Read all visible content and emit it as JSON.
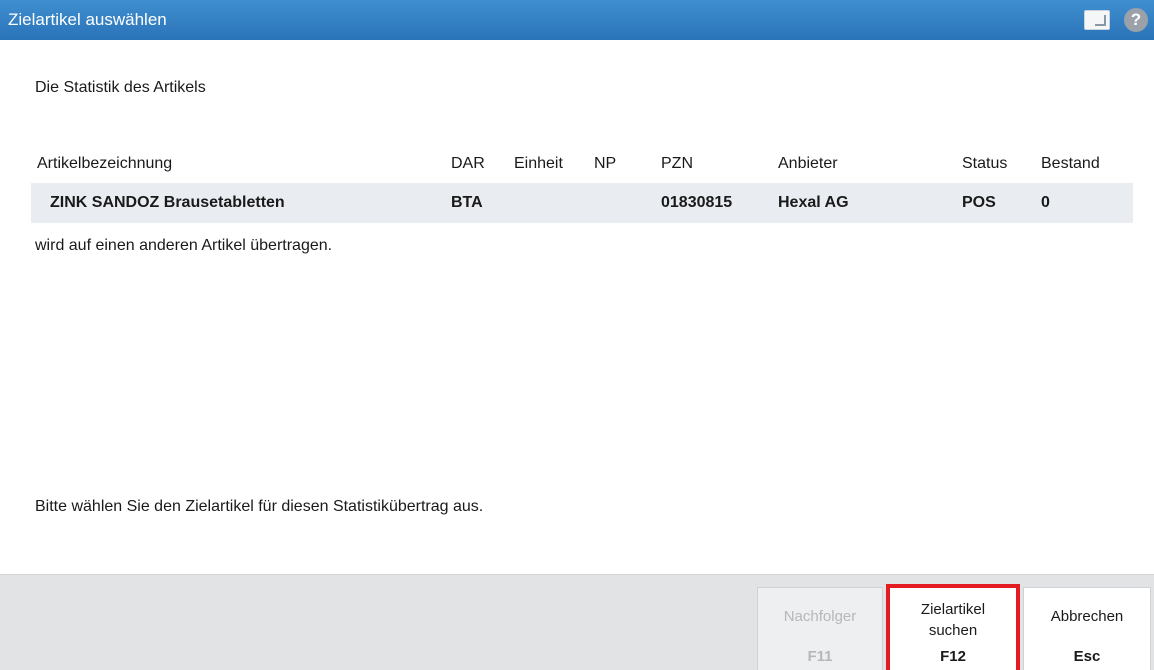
{
  "window": {
    "title": "Zielartikel auswählen",
    "icons": [
      "window-switch-icon",
      "help-icon"
    ],
    "help_glyph": "?"
  },
  "intro": "Die Statistik des Artikels",
  "table": {
    "headers": [
      "Artikelbezeichnung",
      "DAR",
      "Einheit",
      "NP",
      "PZN",
      "Anbieter",
      "Status",
      "Bestand"
    ],
    "row": {
      "name": "ZINK SANDOZ Brausetabletten",
      "dar": "BTA",
      "einheit": "",
      "np": "",
      "pzn": "01830815",
      "anbieter": "Hexal AG",
      "status": "POS",
      "bestand": "0"
    }
  },
  "note_transfer": "wird auf einen anderen Artikel übertragen.",
  "note_choose": "Bitte wählen Sie den Zielartikel für diesen Statistikübertrag aus.",
  "buttons": {
    "next": {
      "label": "Nachfolger",
      "key": "F11",
      "enabled": false
    },
    "search": {
      "label": "Zielartikel suchen",
      "key": "F12",
      "enabled": true,
      "highlight_color": "#e31b23"
    },
    "cancel": {
      "label": "Abbrechen",
      "key": "Esc",
      "enabled": true
    }
  },
  "colors": {
    "titlebar": "#2f7dc2",
    "row_bg": "#e9edf1",
    "footer_bg": "#e1e3e5"
  }
}
